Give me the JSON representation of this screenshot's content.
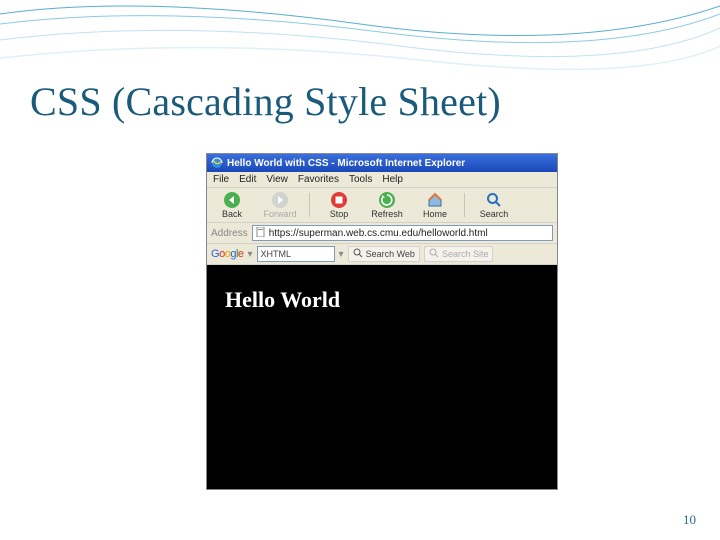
{
  "slide": {
    "title": "CSS (Cascading Style Sheet)",
    "page_number": "10"
  },
  "browser": {
    "window_title": "Hello World with CSS - Microsoft Internet Explorer",
    "menu": {
      "file": "File",
      "edit": "Edit",
      "view": "View",
      "favorites": "Favorites",
      "tools": "Tools",
      "help": "Help"
    },
    "toolbar": {
      "back": "Back",
      "forward": "Forward",
      "stop": "Stop",
      "refresh": "Refresh",
      "home": "Home",
      "search": "Search"
    },
    "address": {
      "label": "Address",
      "url": "https://superman.web.cs.cmu.edu/helloworld.html"
    },
    "google_bar": {
      "logo": "Google",
      "query": "XHTML",
      "search_web": "Search Web",
      "search_site": "Search Site"
    },
    "page": {
      "heading": "Hello World"
    }
  }
}
